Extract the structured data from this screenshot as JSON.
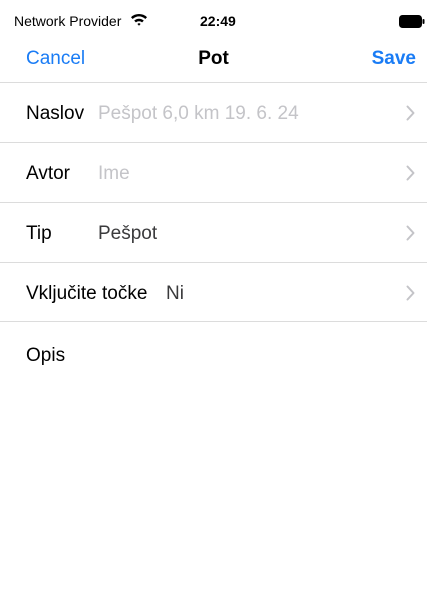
{
  "status_bar": {
    "carrier": "Network Provider",
    "time": "22:49",
    "wifi_icon": "wifi-icon",
    "battery_icon": "battery-full-icon"
  },
  "nav": {
    "cancel_label": "Cancel",
    "title": "Pot",
    "save_label": "Save"
  },
  "form": {
    "rows": [
      {
        "label": "Naslov",
        "value": "Pešpot 6,0 km 19. 6. 24",
        "is_placeholder": true,
        "icon": "chevron-right-icon"
      },
      {
        "label": "Avtor",
        "value": "Ime",
        "is_placeholder": true,
        "icon": "chevron-right-icon"
      },
      {
        "label": "Tip",
        "value": "Pešpot",
        "is_placeholder": false,
        "icon": "chevron-right-icon"
      },
      {
        "label": "Vključite točke",
        "value": "Ni",
        "is_placeholder": false,
        "icon": "chevron-right-icon"
      }
    ],
    "description_label": "Opis"
  },
  "colors": {
    "accent": "#1a7cf5",
    "placeholder": "#c4c4c8",
    "separator": "#dcdcdc"
  }
}
